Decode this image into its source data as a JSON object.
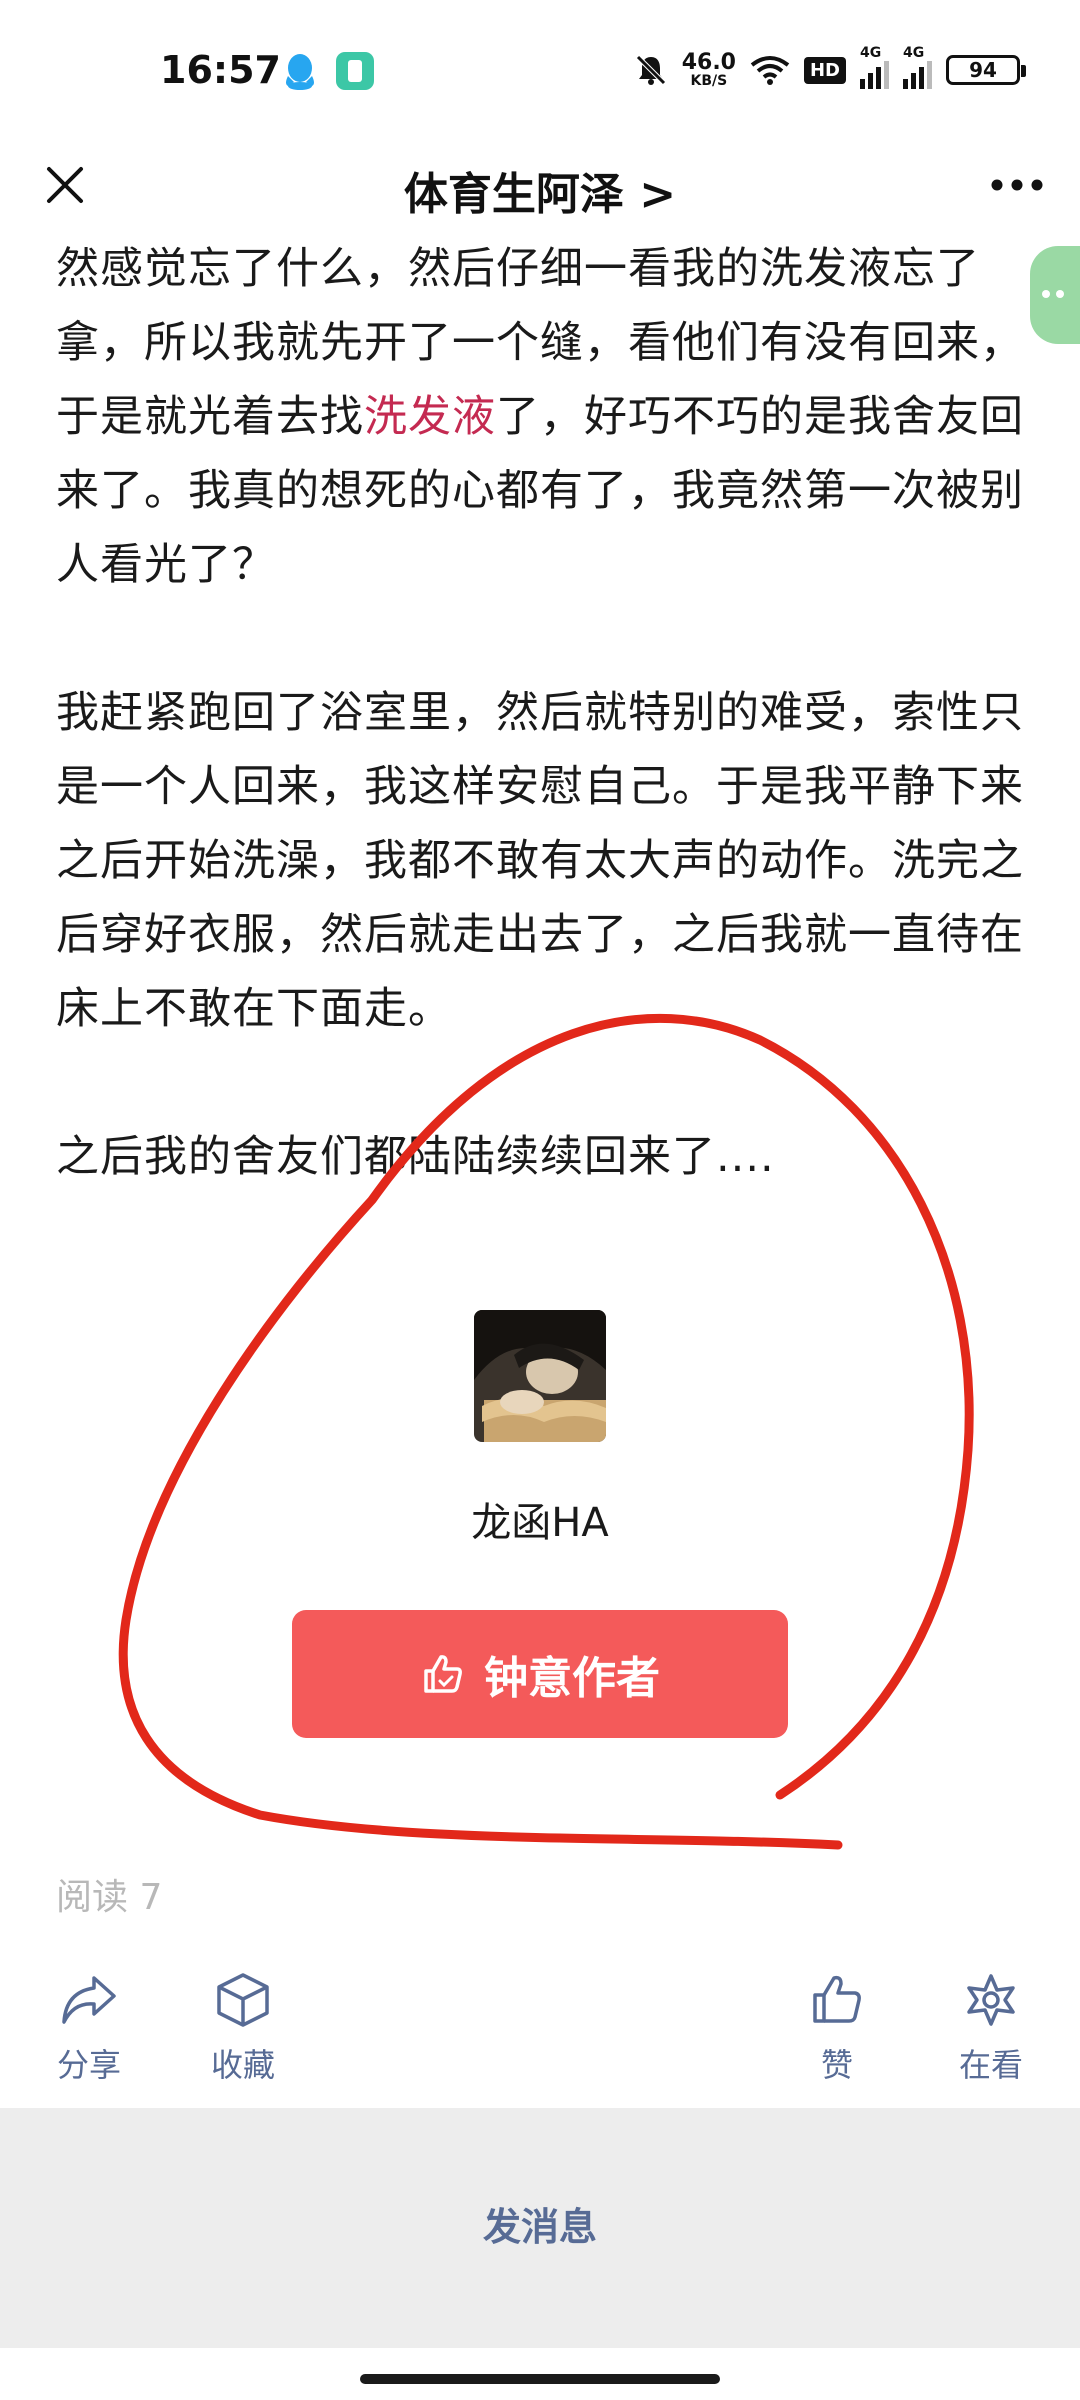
{
  "status_bar": {
    "time": "16:57",
    "net_speed_value": "46.0",
    "net_speed_unit": "KB/S",
    "hd_badge": "HD",
    "signal_1_label": "4G",
    "signal_2_label": "4G",
    "battery": "94"
  },
  "nav": {
    "title": "体育生阿泽 >"
  },
  "article": {
    "para1_a": "然感觉忘了什么，然后仔细一看我的洗发液忘了拿，所以我就先开了一个缝，看他们有没有回来，于是就光着去找",
    "para1_link": "洗发液",
    "para1_b": "了，好巧不巧的是我舍友回来了。我真的想死的心都有了，我竟然第一次被别人看光了？",
    "para2": "我赶紧跑回了浴室里，然后就特别的难受，索性只是一个人回来，我这样安慰自己。于是我平静下来之后开始洗澡，我都不敢有太大声的动作。洗完之后穿好衣服，然后就走出去了，之后我就一直待在床上不敢在下面走。",
    "para3": "之后我的舍友们都陆陆续续回来了...."
  },
  "author": {
    "name": "龙函HA",
    "follow_label": "钟意作者"
  },
  "read_count": "阅读 7",
  "actions": {
    "share": "分享",
    "favorite": "收藏",
    "like": "赞",
    "watching": "在看"
  },
  "footer": {
    "send_message": "发消息"
  },
  "colors": {
    "accent_red": "#f45a5a",
    "link_red": "#c42a51",
    "action_blue": "#576b95",
    "annotation_red": "#e2281a"
  },
  "icons": {
    "close": "close-icon",
    "more": "more-icon",
    "follow": "thumbs-up-icon",
    "share": "share-arrow-icon",
    "favorite": "cube-icon",
    "like": "thumbs-up-icon",
    "watching": "star-icon"
  }
}
